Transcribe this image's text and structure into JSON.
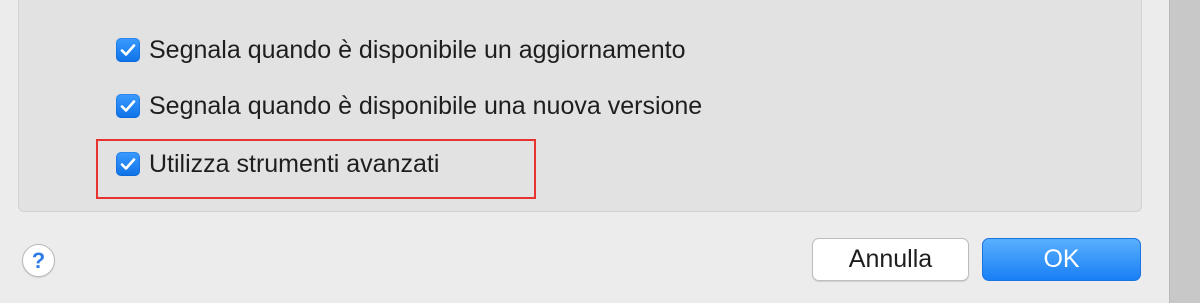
{
  "dialog": {
    "options": [
      {
        "label": "Segnala quando è disponibile un aggiornamento",
        "checked": true
      },
      {
        "label": "Segnala quando è disponibile una nuova versione",
        "checked": true
      },
      {
        "label": "Utilizza strumenti avanzati",
        "checked": true,
        "highlighted": true
      }
    ],
    "help_label": "?",
    "cancel_label": "Annulla",
    "ok_label": "OK"
  },
  "colors": {
    "accent": "#1a84ff",
    "highlight": "#e8332e",
    "panel_background": "#e2e2e2",
    "window_background": "#ececec"
  },
  "icons": {
    "checkbox": "checkmark-icon",
    "help": "question-mark-icon"
  }
}
